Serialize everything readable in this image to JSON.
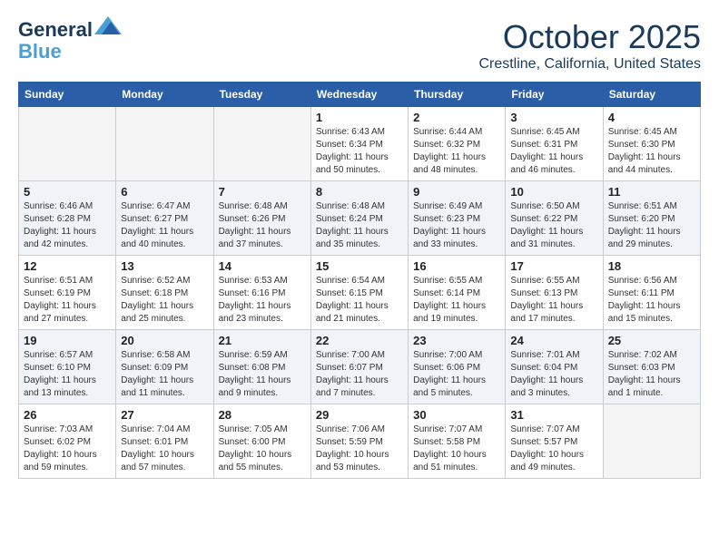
{
  "header": {
    "logo_line1": "General",
    "logo_line2": "Blue",
    "month": "October 2025",
    "location": "Crestline, California, United States"
  },
  "weekdays": [
    "Sunday",
    "Monday",
    "Tuesday",
    "Wednesday",
    "Thursday",
    "Friday",
    "Saturday"
  ],
  "weeks": [
    [
      {
        "day": "",
        "info": ""
      },
      {
        "day": "",
        "info": ""
      },
      {
        "day": "",
        "info": ""
      },
      {
        "day": "1",
        "info": "Sunrise: 6:43 AM\nSunset: 6:34 PM\nDaylight: 11 hours\nand 50 minutes."
      },
      {
        "day": "2",
        "info": "Sunrise: 6:44 AM\nSunset: 6:32 PM\nDaylight: 11 hours\nand 48 minutes."
      },
      {
        "day": "3",
        "info": "Sunrise: 6:45 AM\nSunset: 6:31 PM\nDaylight: 11 hours\nand 46 minutes."
      },
      {
        "day": "4",
        "info": "Sunrise: 6:45 AM\nSunset: 6:30 PM\nDaylight: 11 hours\nand 44 minutes."
      }
    ],
    [
      {
        "day": "5",
        "info": "Sunrise: 6:46 AM\nSunset: 6:28 PM\nDaylight: 11 hours\nand 42 minutes."
      },
      {
        "day": "6",
        "info": "Sunrise: 6:47 AM\nSunset: 6:27 PM\nDaylight: 11 hours\nand 40 minutes."
      },
      {
        "day": "7",
        "info": "Sunrise: 6:48 AM\nSunset: 6:26 PM\nDaylight: 11 hours\nand 37 minutes."
      },
      {
        "day": "8",
        "info": "Sunrise: 6:48 AM\nSunset: 6:24 PM\nDaylight: 11 hours\nand 35 minutes."
      },
      {
        "day": "9",
        "info": "Sunrise: 6:49 AM\nSunset: 6:23 PM\nDaylight: 11 hours\nand 33 minutes."
      },
      {
        "day": "10",
        "info": "Sunrise: 6:50 AM\nSunset: 6:22 PM\nDaylight: 11 hours\nand 31 minutes."
      },
      {
        "day": "11",
        "info": "Sunrise: 6:51 AM\nSunset: 6:20 PM\nDaylight: 11 hours\nand 29 minutes."
      }
    ],
    [
      {
        "day": "12",
        "info": "Sunrise: 6:51 AM\nSunset: 6:19 PM\nDaylight: 11 hours\nand 27 minutes."
      },
      {
        "day": "13",
        "info": "Sunrise: 6:52 AM\nSunset: 6:18 PM\nDaylight: 11 hours\nand 25 minutes."
      },
      {
        "day": "14",
        "info": "Sunrise: 6:53 AM\nSunset: 6:16 PM\nDaylight: 11 hours\nand 23 minutes."
      },
      {
        "day": "15",
        "info": "Sunrise: 6:54 AM\nSunset: 6:15 PM\nDaylight: 11 hours\nand 21 minutes."
      },
      {
        "day": "16",
        "info": "Sunrise: 6:55 AM\nSunset: 6:14 PM\nDaylight: 11 hours\nand 19 minutes."
      },
      {
        "day": "17",
        "info": "Sunrise: 6:55 AM\nSunset: 6:13 PM\nDaylight: 11 hours\nand 17 minutes."
      },
      {
        "day": "18",
        "info": "Sunrise: 6:56 AM\nSunset: 6:11 PM\nDaylight: 11 hours\nand 15 minutes."
      }
    ],
    [
      {
        "day": "19",
        "info": "Sunrise: 6:57 AM\nSunset: 6:10 PM\nDaylight: 11 hours\nand 13 minutes."
      },
      {
        "day": "20",
        "info": "Sunrise: 6:58 AM\nSunset: 6:09 PM\nDaylight: 11 hours\nand 11 minutes."
      },
      {
        "day": "21",
        "info": "Sunrise: 6:59 AM\nSunset: 6:08 PM\nDaylight: 11 hours\nand 9 minutes."
      },
      {
        "day": "22",
        "info": "Sunrise: 7:00 AM\nSunset: 6:07 PM\nDaylight: 11 hours\nand 7 minutes."
      },
      {
        "day": "23",
        "info": "Sunrise: 7:00 AM\nSunset: 6:06 PM\nDaylight: 11 hours\nand 5 minutes."
      },
      {
        "day": "24",
        "info": "Sunrise: 7:01 AM\nSunset: 6:04 PM\nDaylight: 11 hours\nand 3 minutes."
      },
      {
        "day": "25",
        "info": "Sunrise: 7:02 AM\nSunset: 6:03 PM\nDaylight: 11 hours\nand 1 minute."
      }
    ],
    [
      {
        "day": "26",
        "info": "Sunrise: 7:03 AM\nSunset: 6:02 PM\nDaylight: 10 hours\nand 59 minutes."
      },
      {
        "day": "27",
        "info": "Sunrise: 7:04 AM\nSunset: 6:01 PM\nDaylight: 10 hours\nand 57 minutes."
      },
      {
        "day": "28",
        "info": "Sunrise: 7:05 AM\nSunset: 6:00 PM\nDaylight: 10 hours\nand 55 minutes."
      },
      {
        "day": "29",
        "info": "Sunrise: 7:06 AM\nSunset: 5:59 PM\nDaylight: 10 hours\nand 53 minutes."
      },
      {
        "day": "30",
        "info": "Sunrise: 7:07 AM\nSunset: 5:58 PM\nDaylight: 10 hours\nand 51 minutes."
      },
      {
        "day": "31",
        "info": "Sunrise: 7:07 AM\nSunset: 5:57 PM\nDaylight: 10 hours\nand 49 minutes."
      },
      {
        "day": "",
        "info": ""
      }
    ]
  ]
}
